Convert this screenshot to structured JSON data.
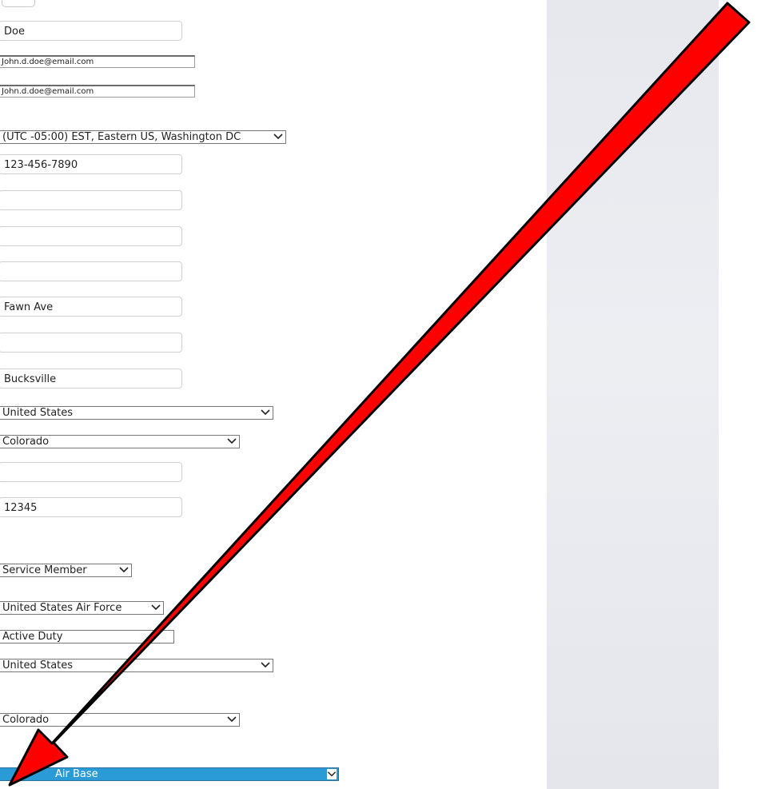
{
  "form": {
    "last_name": "Doe",
    "email": "John.d.doe@email.com",
    "email_confirm": "John.d.doe@email.com",
    "timezone": "(UTC -05:00) EST, Eastern US, Washington DC",
    "phone": "123-456-7890",
    "phone2": "",
    "phone3": "",
    "phone4": "",
    "address1": "Fawn Ave",
    "address2": "",
    "city": "Bucksville",
    "country": "United States",
    "state": "Colorado",
    "county": "",
    "zip": "12345",
    "affiliation": "Service Member",
    "branch": "United States Air Force",
    "status": "Active Duty",
    "duty_country": "United States",
    "duty_state": "Colorado",
    "installation": "Air Base"
  },
  "colors": {
    "arrow_fill": "#ff0000",
    "arrow_stroke": "#000000",
    "selected_select_bg": "#2b9bd8",
    "side_panel": "#e8eaef"
  },
  "icons": {
    "select_chevron": "chevron-down-icon",
    "annotation": "red-arrow-icon"
  }
}
